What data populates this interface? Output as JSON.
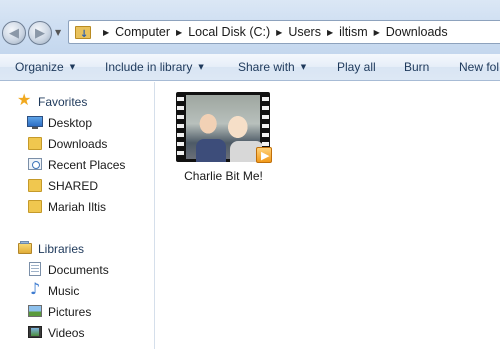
{
  "address_bar": {
    "breadcrumbs": [
      "Computer",
      "Local Disk (C:)",
      "Users",
      "iltism",
      "Downloads"
    ],
    "icons": {
      "back": "back-arrow-icon",
      "forward": "forward-arrow-icon",
      "location": "downloads-folder-icon"
    }
  },
  "toolbar": {
    "organize": "Organize",
    "include_in_library": "Include in library",
    "share_with": "Share with",
    "play_all": "Play all",
    "burn": "Burn",
    "new_folder": "New fol"
  },
  "sidebar": {
    "favorites": {
      "label": "Favorites",
      "items": [
        {
          "label": "Desktop",
          "icon": "desktop-icon"
        },
        {
          "label": "Downloads",
          "icon": "downloads-folder-icon"
        },
        {
          "label": "Recent Places",
          "icon": "recent-places-icon"
        },
        {
          "label": "SHARED",
          "icon": "folder-icon"
        },
        {
          "label": "Mariah Iltis",
          "icon": "folder-icon"
        }
      ]
    },
    "libraries": {
      "label": "Libraries",
      "items": [
        {
          "label": "Documents",
          "icon": "documents-icon"
        },
        {
          "label": "Music",
          "icon": "music-icon"
        },
        {
          "label": "Pictures",
          "icon": "pictures-icon"
        },
        {
          "label": "Videos",
          "icon": "videos-icon"
        }
      ]
    }
  },
  "files": [
    {
      "name": "Charlie Bit Me!",
      "type": "video",
      "icon": "video-thumbnail"
    }
  ],
  "colors": {
    "toolbar_text": "#1e395b",
    "accent_star": "#f1a91f",
    "folder": "#f0c74f"
  }
}
